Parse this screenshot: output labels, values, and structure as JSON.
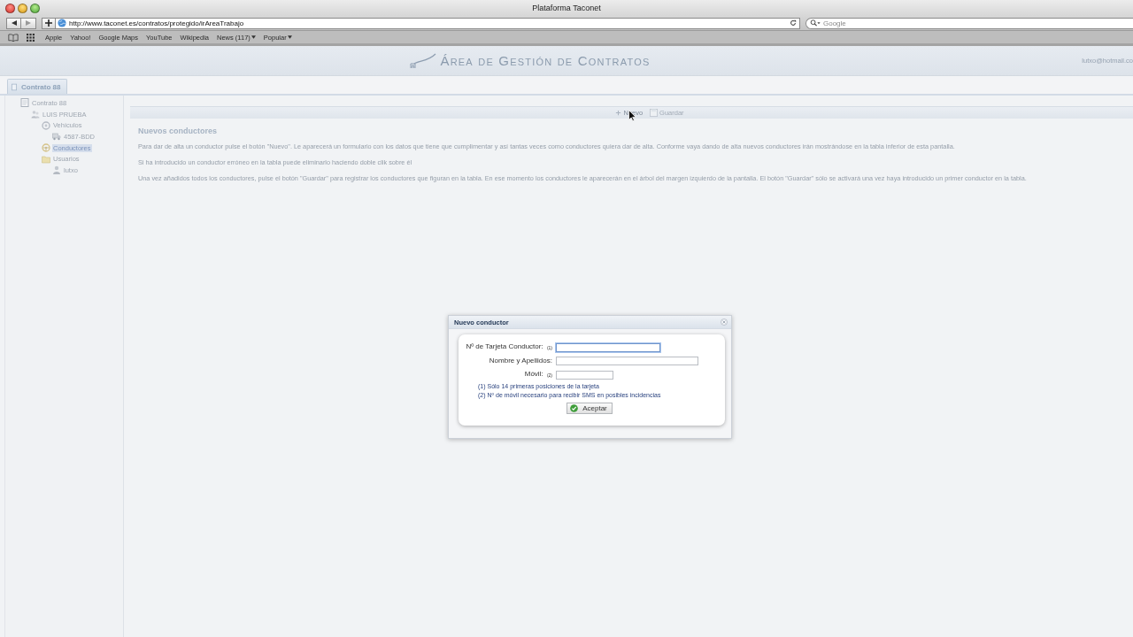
{
  "window": {
    "title": "Plataforma Taconet"
  },
  "browser": {
    "url": "http://www.taconet.es/contratos/protegido/irAreaTrabajo",
    "search": {
      "placeholder": "Google"
    },
    "bookmarks": [
      {
        "label": "Apple",
        "kind": "link"
      },
      {
        "label": "Yahoo!",
        "kind": "link"
      },
      {
        "label": "Google Maps",
        "kind": "link"
      },
      {
        "label": "YouTube",
        "kind": "link"
      },
      {
        "label": "Wikipedia",
        "kind": "link"
      },
      {
        "label": "News (117)",
        "kind": "menu"
      },
      {
        "label": "Popular",
        "kind": "menu"
      }
    ]
  },
  "header": {
    "title": "Área de Gestión de Contratos",
    "user": "lutxo@hotmail.co"
  },
  "tabs": [
    {
      "label": "Contrato 88",
      "selected": true
    }
  ],
  "tree": [
    {
      "label": "Contrato 88",
      "kind": "contract",
      "selected": false,
      "children": [
        {
          "label": "LUIS PRUEBA",
          "kind": "client",
          "selected": false,
          "children": [
            {
              "label": "Vehículos",
              "kind": "vehicles",
              "selected": false,
              "children": [
                {
                  "label": "4587-BDD",
                  "kind": "vehicle",
                  "selected": false
                }
              ]
            },
            {
              "label": "Conductores",
              "kind": "drivers",
              "selected": true
            },
            {
              "label": "Usuarios",
              "kind": "users",
              "selected": false,
              "children": [
                {
                  "label": "lutxo",
                  "kind": "user",
                  "selected": false
                }
              ]
            }
          ]
        }
      ]
    }
  ],
  "toolbar": [
    {
      "label": "Nuevo",
      "kind": "add",
      "disabled": false
    },
    {
      "label": "Guardar",
      "kind": "save",
      "disabled": true
    }
  ],
  "content": {
    "heading": "Nuevos conductores",
    "paragraphs": [
      "Para dar de alta un conductor pulse el botón \"Nuevo\". Le aparecerá un formulario con los datos que tiene que cumplimentar y así tantas veces como conductores quiera dar de alta. Conforme vaya dando de alta nuevos conductores irán mostrándose en la tabla inferior de esta pantalla.",
      "Si ha introducido un conductor erróneo en la tabla puede eliminarlo haciendo doble clik sobre él",
      "Una vez añadidos todos los conductores, pulse el botón \"Guardar\" para registrar los conductores que figuran en la tabla. En ese momento los conductores le aparecerán en el árbol del margen izquierdo de la pantalla. El botón \"Guardar\" sólo se activará una vez haya introducido un primer conductor en la tabla."
    ]
  },
  "dialog": {
    "title": "Nuevo conductor",
    "fields": [
      {
        "label": "Nº de Tarjeta Conductor: $_{(1)}$",
        "focused": true
      },
      {
        "label": "Nombre y Apellidos:",
        "focused": false
      },
      {
        "label": "Móvil: $_{(2)}$",
        "focused": false
      }
    ],
    "notes": [
      "(1) Sólo 14 primeras posiciones de la tarjeta",
      "(2) Nº de móvil necesario para recibir SMS en posibles incidencias"
    ],
    "button": "Aceptar"
  }
}
